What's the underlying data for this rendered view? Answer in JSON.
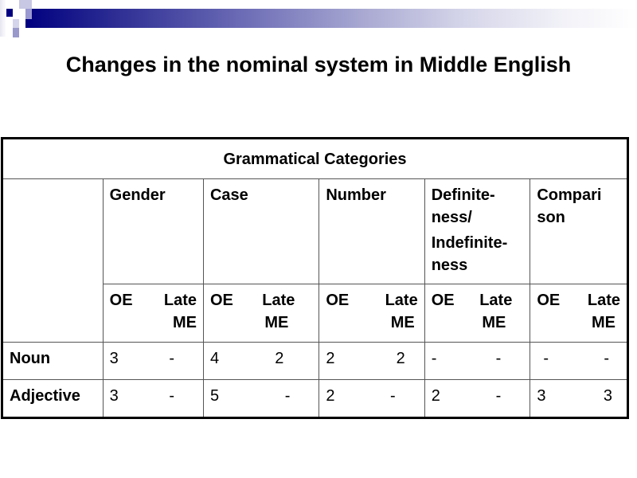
{
  "slide": {
    "title": "Changes in the nominal system in Middle English"
  },
  "table": {
    "group_header": "Grammatical Categories",
    "categories": [
      {
        "label": "Gender"
      },
      {
        "label": "Case"
      },
      {
        "label": "Number"
      },
      {
        "label_lines": [
          "Definite-",
          "ness/",
          "Indefinite-",
          "ness"
        ]
      },
      {
        "label_lines": [
          "Compari",
          "son"
        ]
      }
    ],
    "period_labels": {
      "oe": "OE",
      "late": "Late",
      "me": "ME"
    },
    "rows": [
      {
        "label": "Noun",
        "values": [
          {
            "oe": "3",
            "late_me": "-"
          },
          {
            "oe": "4",
            "late_me": "2"
          },
          {
            "oe": "2",
            "late_me": "2"
          },
          {
            "oe": "-",
            "late_me": "-"
          },
          {
            "oe": "-",
            "late_me": "-"
          }
        ]
      },
      {
        "label": "Adjective",
        "values": [
          {
            "oe": "3",
            "late_me": "-"
          },
          {
            "oe": "5",
            "late_me": "-"
          },
          {
            "oe": "2",
            "late_me": "-"
          },
          {
            "oe": "2",
            "late_me": "-"
          },
          {
            "oe": "3",
            "late_me": "3"
          }
        ]
      }
    ]
  }
}
